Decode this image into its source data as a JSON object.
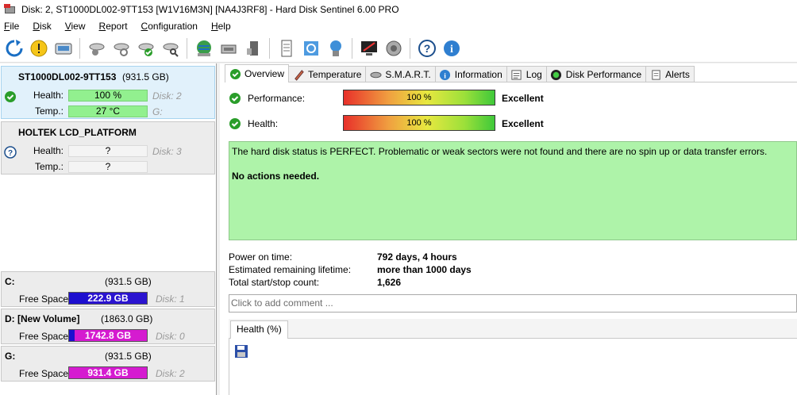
{
  "window": {
    "title": "Disk: 2, ST1000DL002-9TT153 [W1V16M3N]  [NA4J3RF8] -  Hard Disk Sentinel 6.00 PRO"
  },
  "menu": {
    "items": [
      {
        "first": "F",
        "rest": "ile"
      },
      {
        "first": "D",
        "rest": "isk"
      },
      {
        "first": "V",
        "rest": "iew"
      },
      {
        "first": "R",
        "rest": "eport"
      },
      {
        "first": "C",
        "rest": "onfiguration"
      },
      {
        "first": "H",
        "rest": "elp"
      }
    ]
  },
  "toolbar": {
    "icons": [
      "refresh-icon",
      "warning-icon",
      "disk-properties-icon",
      "disk-satellite-icon",
      "disk-refresh-icon",
      "disk-check-icon",
      "disk-search-icon",
      "globe-disk-icon",
      "disk-tools-icon",
      "disk-usb-icon",
      "document-list-icon",
      "sync-icon",
      "network-disk-icon",
      "monitor-warning-icon",
      "sound-icon",
      "help-icon",
      "info-icon"
    ]
  },
  "disks": [
    {
      "name": "ST1000DL002-9TT153",
      "size": "(931.5 GB)",
      "health_label": "Health:",
      "health_value": "100 %",
      "health_fraction": 1.0,
      "temp_label": "Temp.:",
      "temp_value": "27 °C",
      "disk_ref": "Disk: 2",
      "drive_ref": "G:",
      "status": "ok"
    },
    {
      "name": "HOLTEK LCD_PLATFORM",
      "size": "",
      "health_label": "Health:",
      "health_value": "?",
      "temp_label": "Temp.:",
      "temp_value": "?",
      "disk_ref": "Disk: 3",
      "status": "unknown"
    }
  ],
  "volumes": [
    {
      "letter": "C:",
      "size": "(931.5 GB)",
      "free_label": "Free Space",
      "free_value": "222.9 GB",
      "free_fraction": 0.239,
      "disk_ref": "Disk: 1",
      "color_fill": "#1d0fcf",
      "color_rest": "#c84fd6"
    },
    {
      "letter": "D: [New Volume]",
      "size": "(1863.0 GB)",
      "free_label": "Free Space",
      "free_value": "1742.8 GB",
      "free_fraction": 0.935,
      "disk_ref": "Disk: 0",
      "color_fill": "#d51bd0",
      "color_rest": "#1d0fcf"
    },
    {
      "letter": "G:",
      "size": "(931.5 GB)",
      "free_label": "Free Space",
      "free_value": "931.4 GB",
      "free_fraction": 1.0,
      "disk_ref": "Disk: 2",
      "color_fill": "#d51bd0",
      "color_rest": "#d51bd0"
    }
  ],
  "tabs": [
    {
      "label": "Overview",
      "icon": "check-circle-icon",
      "active": true
    },
    {
      "label": "Temperature",
      "icon": "thermometer-icon",
      "active": false
    },
    {
      "label": "S.M.A.R.T.",
      "icon": "disk-arrows-icon",
      "active": false
    },
    {
      "label": "Information",
      "icon": "info-icon",
      "active": false
    },
    {
      "label": "Log",
      "icon": "log-icon",
      "active": false
    },
    {
      "label": "Disk Performance",
      "icon": "gauge-icon",
      "active": false
    },
    {
      "label": "Alerts",
      "icon": "alerts-icon",
      "active": false
    }
  ],
  "overview": {
    "performance": {
      "label": "Performance:",
      "value": "100 %",
      "word": "Excellent"
    },
    "health": {
      "label": "Health:",
      "value": "100 %",
      "word": "Excellent"
    },
    "status_text": "The hard disk status is PERFECT. Problematic or weak sectors were not found and there are no spin up or data transfer errors.",
    "actions_text": "No actions needed.",
    "info": [
      {
        "label": "Power on time:",
        "value": "792 days, 4 hours"
      },
      {
        "label": "Estimated remaining lifetime:",
        "value": "more than 1000 days"
      },
      {
        "label": "Total start/stop count:",
        "value": "1,626"
      }
    ],
    "comment_placeholder": "Click to add comment ...",
    "chart_tab": "Health (%)"
  },
  "colors": {
    "ok_green": "#2a9d2a",
    "status_bg": "#aef3a9",
    "selected_bg": "#e1f1fb"
  }
}
